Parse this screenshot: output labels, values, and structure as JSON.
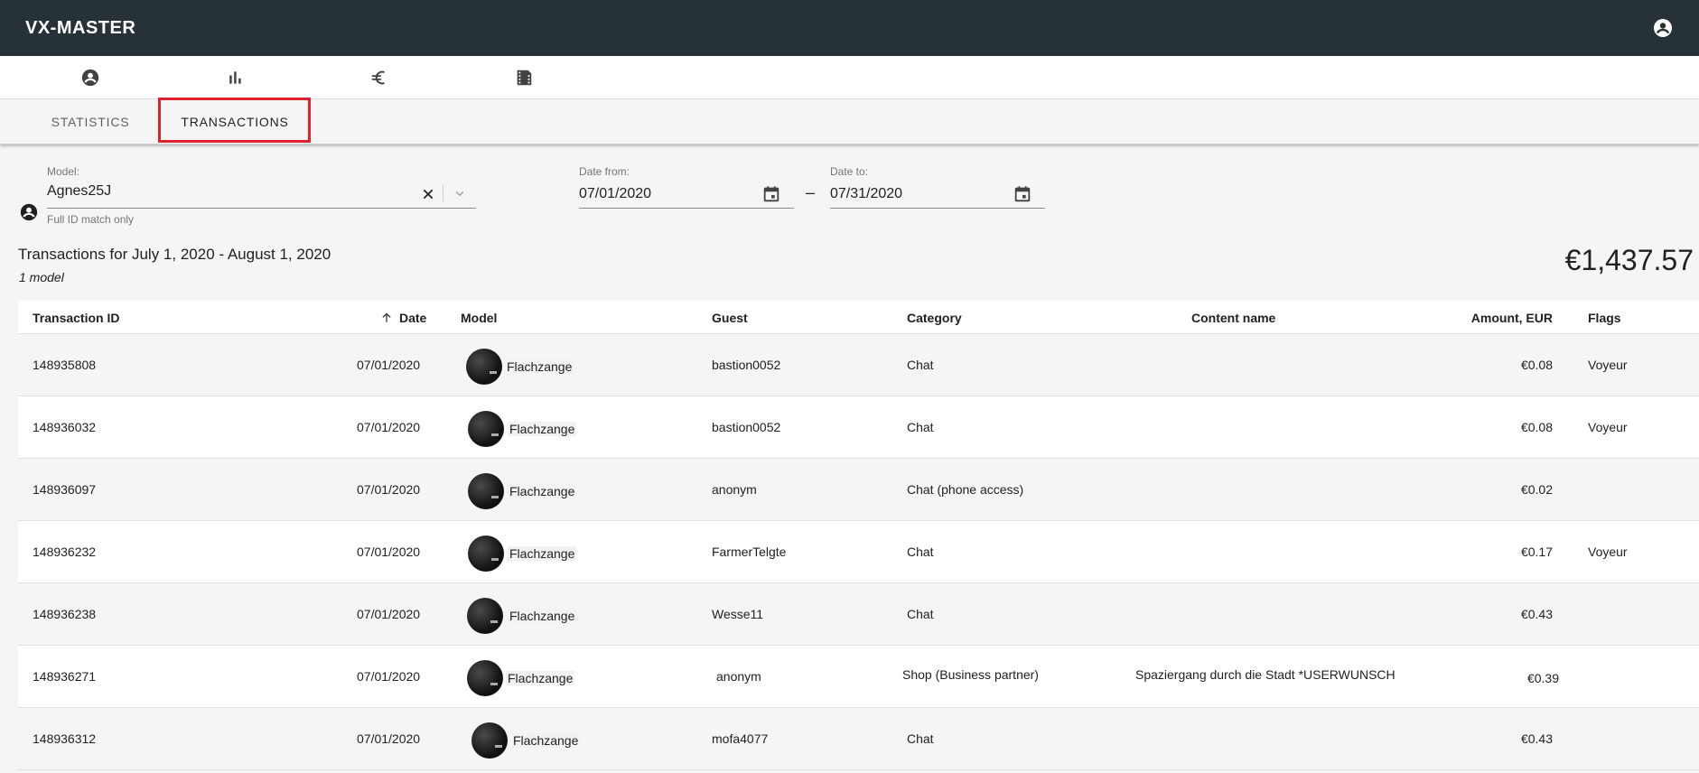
{
  "app": {
    "title": "VX-MASTER"
  },
  "icons": {
    "account": "account-circle-icon",
    "person": "person-icon",
    "stats": "bar-chart-icon",
    "euro": "euro-icon",
    "media": "film-icon",
    "clear": "close-icon",
    "dropdown": "chevron-down-icon",
    "calendar": "calendar-icon",
    "sort": "arrow-up-icon"
  },
  "tabs": [
    {
      "label": "STATISTICS",
      "active": false
    },
    {
      "label": "TRANSACTIONS",
      "active": true
    }
  ],
  "filters": {
    "model": {
      "label": "Model:",
      "value": "Agnes25J",
      "hint": "Full ID match only"
    },
    "date_from": {
      "label": "Date from:",
      "value": "07/01/2020"
    },
    "separator": "–",
    "date_to": {
      "label": "Date to:",
      "value": "07/31/2020"
    }
  },
  "summary": {
    "title": "Transactions for July 1, 2020 - August 1, 2020",
    "subtitle": "1 model",
    "total": "€1,437.57"
  },
  "table": {
    "headers": {
      "id": "Transaction ID",
      "date": "Date",
      "model": "Model",
      "guest": "Guest",
      "category": "Category",
      "content": "Content name",
      "amount": "Amount, EUR",
      "flags": "Flags"
    },
    "rows": [
      {
        "id": "148935808",
        "date": "07/01/2020",
        "model": "Flachzange",
        "guest": "bastion0052",
        "category": "Chat",
        "content": "",
        "amount": "€0.08",
        "flags": "Voyeur"
      },
      {
        "id": "148936032",
        "date": "07/01/2020",
        "model": "Flachzange",
        "guest": "bastion0052",
        "category": "Chat",
        "content": "",
        "amount": "€0.08",
        "flags": "Voyeur"
      },
      {
        "id": "148936097",
        "date": "07/01/2020",
        "model": "Flachzange",
        "guest": "anonym",
        "category": "Chat (phone access)",
        "content": "",
        "amount": "€0.02",
        "flags": ""
      },
      {
        "id": "148936232",
        "date": "07/01/2020",
        "model": "Flachzange",
        "guest": "FarmerTelgte",
        "category": "Chat",
        "content": "",
        "amount": "€0.17",
        "flags": "Voyeur"
      },
      {
        "id": "148936238",
        "date": "07/01/2020",
        "model": "Flachzange",
        "guest": "Wesse11",
        "category": "Chat",
        "content": "",
        "amount": "€0.43",
        "flags": ""
      },
      {
        "id": "148936271",
        "date": "07/01/2020",
        "model": "Flachzange",
        "guest": "anonym",
        "category": "Shop (Business partner)",
        "content": "Spaziergang durch die Stadt *USERWUNSCH",
        "amount": "€0.39",
        "flags": ""
      },
      {
        "id": "148936312",
        "date": "07/01/2020",
        "model": "Flachzange",
        "guest": "mofa4077",
        "category": "Chat",
        "content": "",
        "amount": "€0.43",
        "flags": ""
      }
    ]
  }
}
